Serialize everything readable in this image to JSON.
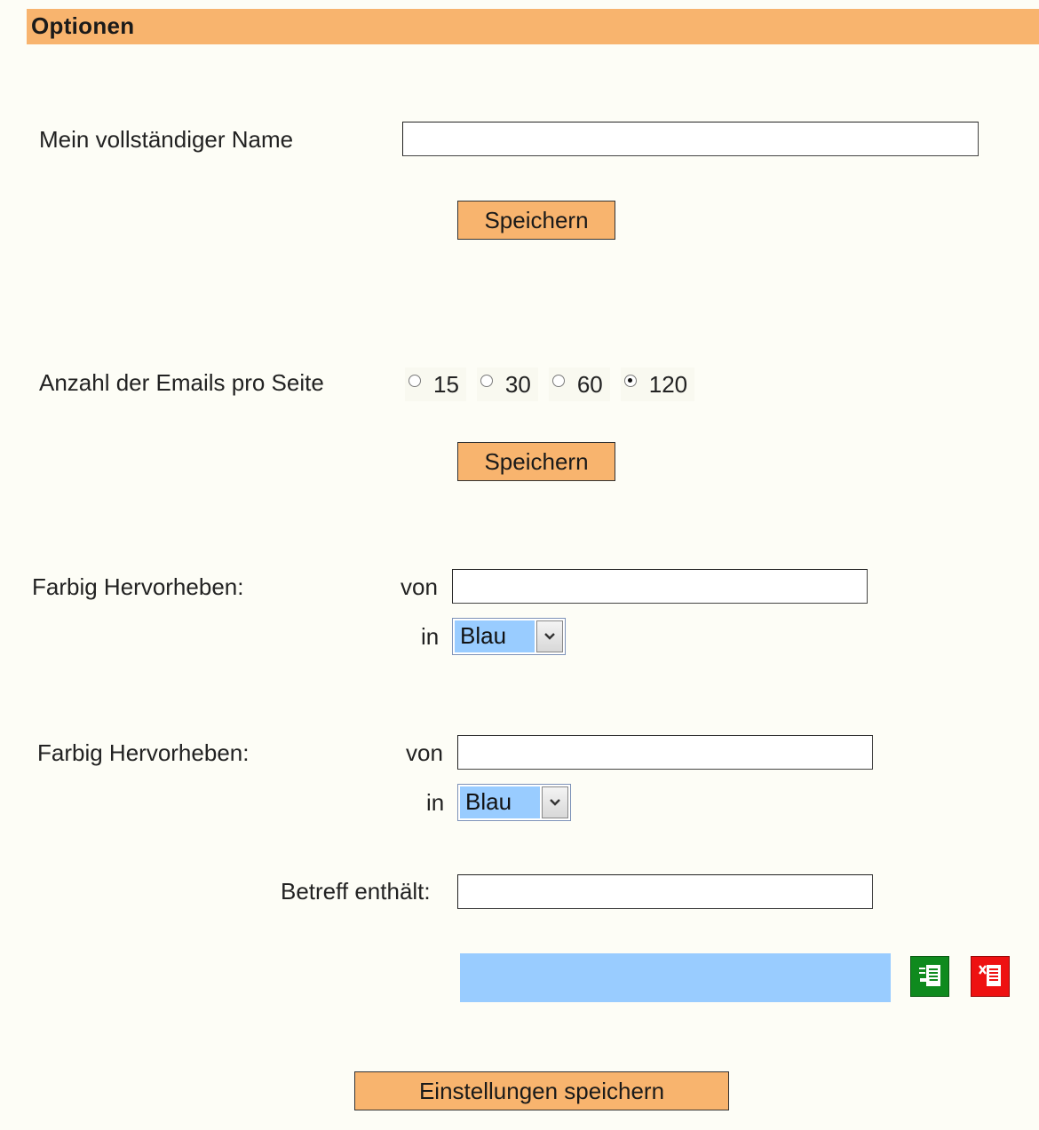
{
  "header": {
    "title": "Optionen"
  },
  "name_section": {
    "label": "Mein vollständiger Name",
    "value": "",
    "save_label": "Speichern"
  },
  "emails_section": {
    "label": "Anzahl der Emails pro Seite",
    "options": [
      "15",
      "30",
      "60",
      "120"
    ],
    "selected": "120",
    "save_label": "Speichern"
  },
  "highlight_1": {
    "label": "Farbig Hervorheben:",
    "from_label": "von",
    "from_value": "",
    "in_label": "in",
    "color_value": "Blau"
  },
  "highlight_2": {
    "label": "Farbig Hervorheben:",
    "from_label": "von",
    "from_value": "",
    "in_label": "in",
    "color_value": "Blau"
  },
  "subject": {
    "label": "Betreff enthält:",
    "value": ""
  },
  "filter_list": {
    "color": "#99ccff",
    "add_icon": "add-filter-icon",
    "delete_icon": "delete-filter-icon"
  },
  "footer": {
    "save_all_label": "Einstellungen speichern"
  },
  "colors": {
    "accent": "#f8b46e",
    "background": "#fdfdf6",
    "selection_blue": "#99ccff",
    "icon_green": "#0f8a1e",
    "icon_red": "#ee1111"
  }
}
